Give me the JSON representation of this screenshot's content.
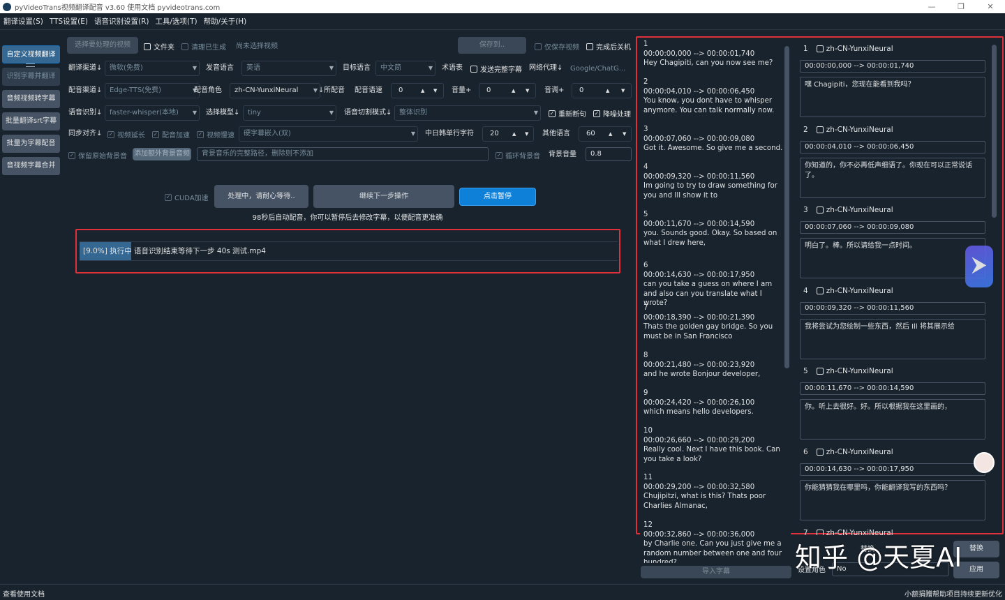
{
  "window": {
    "title": "pyVideoTrans视频翻译配音 v3.60  使用文档  pyvideotrans.com",
    "minimize": "—",
    "maximize": "❐",
    "close": "✕"
  },
  "menu": [
    "翻译设置(S)",
    "TTS设置(E)",
    "语音识别设置(R)",
    "工具/选项(T)",
    "帮助/关于(H)"
  ],
  "sidebar": {
    "items": [
      "自定义视频翻译",
      "识别字幕并翻译",
      "音频视频转字幕",
      "批量翻译srt字幕",
      "批量为字幕配音",
      "音视频字幕合并"
    ]
  },
  "toolbar": {
    "select_video": "选择要处理的视频",
    "folder": "文件夹",
    "clear_generated": "清理已生成",
    "no_video": "尚未选择视频",
    "save_to": "保存到..",
    "only_save_video": "仅保存视频",
    "shutdown_after": "完成后关机"
  },
  "row1": {
    "translate_channel_label": "翻译渠道↓",
    "translate_channel": "微软(免费)",
    "source_lang_label": "发音语言",
    "source_lang": "英语",
    "target_lang_label": "目标语言",
    "target_lang": "中文简",
    "glossary": "术语表",
    "send_full_subtitle": "发送完整字幕",
    "proxy_label": "网络代理↓",
    "proxy_placeholder": "Google/ChatG..."
  },
  "row2": {
    "dub_channel_label": "配音渠道↓",
    "dub_channel": "Edge-TTS(免费)",
    "dub_role_label": "配音角色",
    "dub_role": "zh-CN-YunxiNeural",
    "dub_role_arrow": "↓",
    "all_dub": "所配音",
    "speed_label": "配音语速",
    "speed_value": "0",
    "volume_label": "音量+",
    "volume_value": "0",
    "pitch_label": "音调+",
    "pitch_value": "0"
  },
  "row3": {
    "asr_label": "语音识别↓",
    "asr_value": "faster-whisper(本地)",
    "model_label": "选择模型↓",
    "model_value": "tiny",
    "split_label": "语音切割模式↓",
    "split_value": "整体识别",
    "resplit": "重新断句",
    "denoise": "降噪处理"
  },
  "row4": {
    "sync_label": "同步对齐↓",
    "video_extend": "视频延长",
    "dub_speedup": "配音加速",
    "video_slowdown": "视频慢速",
    "subtitle_mode": "硬字幕嵌入(双)",
    "cjk_chars_label": "中日韩单行字符",
    "cjk_chars_value": "20",
    "other_lang_label": "其他语言",
    "other_lang_value": "60"
  },
  "row5": {
    "keep_bg": "保留原始背景音",
    "add_bg": "添加额外背景音频",
    "bg_path_placeholder": "背景音乐的完整路径，删除则不添加",
    "loop_bg": "循环背景音",
    "bg_volume_label": "背景音量",
    "bg_volume_value": "0.8"
  },
  "actions": {
    "cuda": "CUDA加速",
    "processing": "处理中，请耐心等待..",
    "next_step": "继续下一步操作",
    "pause": "点击暂停",
    "hint": "98秒后自动配音，你可以暂停后去修改字幕，以便配音更准确"
  },
  "progress": {
    "percent": "[9.0%]",
    "fill_fraction": 0.09,
    "message": "执行中 语音识别结束等待下一步 40s   测试.mp4"
  },
  "subtitles": [
    {
      "idx": "1",
      "time": "00:00:00,000 --> 00:00:01,740",
      "text": "Hey Chagipiti, can you now see me?"
    },
    {
      "idx": "2",
      "time": "00:00:04,010 --> 00:00:06,450",
      "text": "You know, you dont have to whisper anymore. You can talk normally now."
    },
    {
      "idx": "3",
      "time": "00:00:07,060 --> 00:00:09,080",
      "text": "Got it. Awesome. So give me a second."
    },
    {
      "idx": "4",
      "time": "00:00:09,320 --> 00:00:11,560",
      "text": "Im going to try to draw something for you and Ill show it to"
    },
    {
      "idx": "5",
      "time": "00:00:11,670 --> 00:00:14,590",
      "text": "you. Sounds good. Okay. So based on what I drew here,"
    },
    {
      "idx": "6",
      "time": "00:00:14,630 --> 00:00:17,950",
      "text": "can you take a guess on where I am and also can you translate what I wrote?"
    },
    {
      "idx": "7",
      "time": "00:00:18,390 --> 00:00:21,390",
      "text": "Thats the golden gay bridge. So you must be in San Francisco"
    },
    {
      "idx": "8",
      "time": "00:00:21,480 --> 00:00:23,920",
      "text": "and he wrote Bonjour developer,"
    },
    {
      "idx": "9",
      "time": "00:00:24,420 --> 00:00:26,100",
      "text": "which means hello developers."
    },
    {
      "idx": "10",
      "time": "00:00:26,660 --> 00:00:29,200",
      "text": "Really cool. Next I have this book. Can you take a look?"
    },
    {
      "idx": "11",
      "time": "00:00:29,200 --> 00:00:32,580",
      "text": "Chujipitzi, what is this? Thats poor Charlies Almanac,"
    },
    {
      "idx": "12",
      "time": "00:00:32,860 --> 00:00:36,000",
      "text": "by Charlie one. Can you just give me a random number between one and four hundred?"
    }
  ],
  "import_subtitle": "导入字幕",
  "dub_cues": [
    {
      "num": "1",
      "voice": "zh-CN-YunxiNeural",
      "time": "00:00:00,000 --> 00:00:01,740",
      "text": "嘿 Chagipiti，您现在能看到我吗？"
    },
    {
      "num": "2",
      "voice": "zh-CN-YunxiNeural",
      "time": "00:00:04,010 --> 00:00:06,450",
      "text": "你知道的，你不必再低声细语了。你现在可以正常说话了。"
    },
    {
      "num": "3",
      "voice": "zh-CN-YunxiNeural",
      "time": "00:00:07,060 --> 00:00:09,080",
      "text": "明白了。棒。所以请给我一点时间。"
    },
    {
      "num": "4",
      "voice": "zh-CN-YunxiNeural",
      "time": "00:00:09,320 --> 00:00:11,560",
      "text": "我将尝试为您绘制一些东西，然后 Ill 将其展示给"
    },
    {
      "num": "5",
      "voice": "zh-CN-YunxiNeural",
      "time": "00:00:11,670 --> 00:00:14,590",
      "text": "你。听上去很好。好。所以根据我在这里画的，"
    },
    {
      "num": "6",
      "voice": "zh-CN-YunxiNeural",
      "time": "00:00:14,630 --> 00:00:17,950",
      "text": "你能猜猜我在哪里吗，你能翻译我写的东西吗？"
    },
    {
      "num": "7",
      "voice": "zh-CN-YunxiNeural",
      "time": "",
      "text": ""
    }
  ],
  "right_bottom": {
    "replace_label": "替换",
    "replace_btn": "替换",
    "role_label": "设置角色",
    "role_value": "No",
    "apply_btn": "应用"
  },
  "watermark": "知乎 @天夏AI",
  "status": {
    "left": "查看使用文档",
    "right": "小额捐赠帮助项目持续更新优化"
  },
  "colors": {
    "background": "#19232d",
    "button": "#455364",
    "accent_blue": "#0f80d8",
    "highlight_red": "#e0303a",
    "progress_fill": "#346792"
  }
}
